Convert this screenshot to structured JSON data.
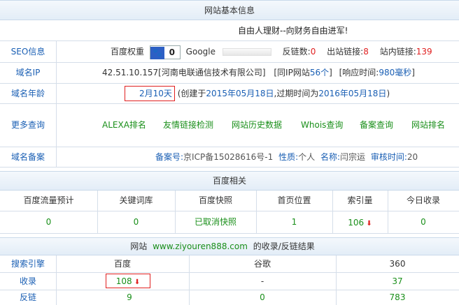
{
  "basic": {
    "title": "网站基本信息",
    "slogan": "自由人理财--向财务自由进军!",
    "seo_label": "SEO信息",
    "baidu_weight_label": "百度权重",
    "baidu_weight_value": "0",
    "google_label": "Google",
    "backlinks_label": "反链数:",
    "backlinks_value": "0",
    "outlinks_label": "出站链接:",
    "outlinks_value": "8",
    "inlinks_label": "站内链接:",
    "inlinks_value": "139",
    "ip_label": "域名IP",
    "ip_value": "42.51.10.157[河南电联通信技术有限公司]",
    "same_ip_prefix": "[同IP网站",
    "same_ip_value": "56个",
    "same_ip_suffix": "]",
    "resp_prefix": "[响应时间:",
    "resp_value": "980毫秒",
    "resp_suffix": "]",
    "age_label": "域名年龄",
    "age_value": "2月10天",
    "age_created_prefix": "(创建于",
    "age_created": "2015年05月18日",
    "age_expire_prefix": ",过期时间为",
    "age_expire": "2016年05月18日",
    "age_suffix": ")",
    "more_label": "更多查询",
    "more_links": [
      "ALEXA排名",
      "友情链接检测",
      "网站历史数据",
      "Whois查询",
      "备案查询",
      "网站排名"
    ],
    "icp_label": "域名备案",
    "icp_no_label": "备案号:",
    "icp_no": "京ICP备15028616号-1",
    "icp_nature_label": "性质:",
    "icp_nature": "个人",
    "icp_name_label": "名称:",
    "icp_name": "闫宗运",
    "icp_time_label": "审核时间:",
    "icp_time": "20"
  },
  "baidu": {
    "title": "百度相关",
    "headers": [
      "百度流量预计",
      "关键词库",
      "百度快照",
      "首页位置",
      "索引量",
      "今日收录"
    ],
    "values": [
      "0",
      "0",
      "已取消快照",
      "1",
      "106",
      "0"
    ]
  },
  "index": {
    "title_prefix": "网站",
    "domain": "www.ziyouren888.com",
    "title_suffix": "的收录/反链结果",
    "engine_label": "搜索引擎",
    "engines": [
      "百度",
      "谷歌",
      "360"
    ],
    "indexed_label": "收录",
    "indexed": [
      "108",
      "-",
      "37"
    ],
    "backlink_label": "反链",
    "backlinks": [
      "9",
      "0",
      "783"
    ]
  },
  "colors": {
    "link_blue": "#1a5fb4",
    "red": "#e02020",
    "green": "#1a8f1a",
    "header_bg": "#e3edf7"
  }
}
